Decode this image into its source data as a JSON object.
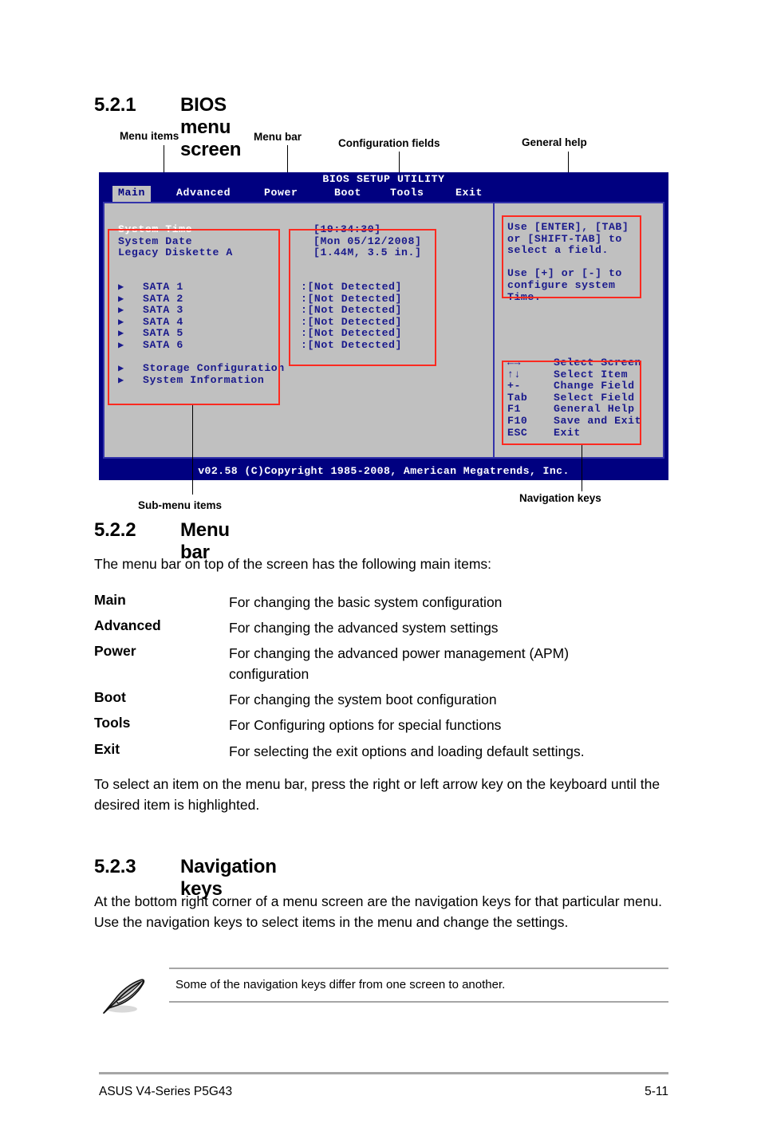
{
  "sections": {
    "s521": {
      "number": "5.2.1",
      "title": "BIOS menu screen"
    },
    "s522": {
      "number": "5.2.2",
      "title": "Menu bar"
    },
    "s523": {
      "number": "5.2.3",
      "title": "Navigation keys"
    }
  },
  "callouts": {
    "menu_items": "Menu items",
    "menu_bar": "Menu bar",
    "configuration_fields": "Configuration fields",
    "general_help": "General help",
    "sub_menu_items": "Sub-menu items",
    "navigation_keys": "Navigation keys"
  },
  "bios": {
    "title": "BIOS SETUP UTILITY",
    "menu_tabs": [
      {
        "label": "Main",
        "active": true
      },
      {
        "label": "Advanced",
        "active": false
      },
      {
        "label": "Power",
        "active": false
      },
      {
        "label": "Boot",
        "active": false
      },
      {
        "label": "Tools",
        "active": false
      },
      {
        "label": "Exit",
        "active": false
      }
    ],
    "settings": [
      {
        "name": "System Time",
        "value": "[19:34:30]",
        "selected": true,
        "submenu": false
      },
      {
        "name": "System Date",
        "value": "[Mon 05/12/2008]",
        "selected": false,
        "submenu": false
      },
      {
        "name": "Legacy Diskette A",
        "value": "[1.44M, 3.5 in.]",
        "selected": false,
        "submenu": false
      }
    ],
    "drives": [
      {
        "name": "SATA 1",
        "value": ":[Not Detected]"
      },
      {
        "name": "SATA 2",
        "value": ":[Not Detected]"
      },
      {
        "name": "SATA 3",
        "value": ":[Not Detected]"
      },
      {
        "name": "SATA 4",
        "value": ":[Not Detected]"
      },
      {
        "name": "SATA 5",
        "value": ":[Not Detected]"
      },
      {
        "name": "SATA 6",
        "value": ":[Not Detected]"
      }
    ],
    "submenus": [
      {
        "name": "Storage Configuration"
      },
      {
        "name": "System Information"
      }
    ],
    "help": {
      "line1": "Use [ENTER], [TAB]",
      "line2": "or [SHIFT-TAB] to",
      "line3": "select a field.",
      "line4": "Use [+] or [-] to",
      "line5": "configure system",
      "line6": "Time."
    },
    "nav_keys": [
      {
        "key": "←→",
        "action": "Select Screen"
      },
      {
        "key": "↑↓",
        "action": "Select Item"
      },
      {
        "key": "+-",
        "action": "Change Field"
      },
      {
        "key": "Tab",
        "action": "Select Field"
      },
      {
        "key": "F1",
        "action": "General Help"
      },
      {
        "key": "F10",
        "action": "Save and Exit"
      },
      {
        "key": "ESC",
        "action": "Exit"
      }
    ],
    "copyright": "v02.58 (C)Copyright 1985-2008, American Megatrends, Inc."
  },
  "menu_bar_section": {
    "intro": "The menu bar on top of the screen has the following main items:",
    "items": [
      {
        "term": "Main",
        "desc": "For changing the basic system configuration"
      },
      {
        "term": "Advanced",
        "desc": "For changing the advanced system settings"
      },
      {
        "term": "Power",
        "desc": "For changing the advanced power management (APM) configuration"
      },
      {
        "term": "Boot",
        "desc": "For changing the system boot configuration"
      },
      {
        "term": "Tools",
        "desc": "For Configuring options for special functions"
      },
      {
        "term": "Exit",
        "desc": "For selecting the exit options and loading default settings."
      }
    ],
    "outro": "To select an item on the menu bar, press the right or left arrow key on the keyboard until the desired item is highlighted."
  },
  "navigation_keys_section": {
    "paragraph": "At the bottom right corner of a menu screen are the navigation keys for that particular menu. Use the navigation keys to select items in the menu and change the settings.",
    "note": "Some of the navigation keys differ from one screen to another."
  },
  "footer": {
    "left": "ASUS V4-Series P5G43",
    "page": "5-11"
  },
  "colors": {
    "bios_background": "#000080",
    "bios_panel": "#c0c0c0",
    "bios_text": "#1a1a8c",
    "annotation_red": "#ff2a20",
    "rule_gray": "#a6a6a6"
  }
}
